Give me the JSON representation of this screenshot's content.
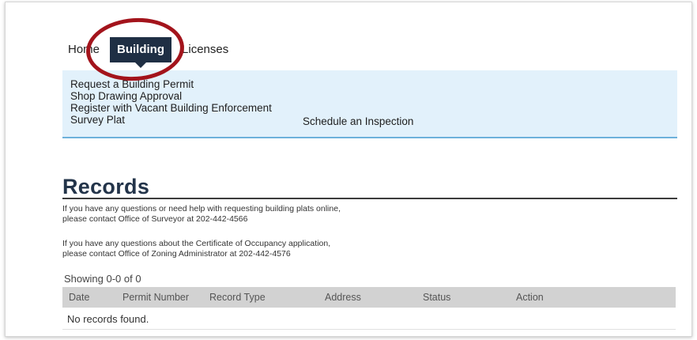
{
  "tabs": [
    {
      "label": "Home",
      "active": false
    },
    {
      "label": "Building",
      "active": true
    },
    {
      "label": "Licenses",
      "active": false
    }
  ],
  "building_menu": {
    "links": [
      "Request a Building Permit",
      "Shop Drawing Approval",
      "Register with Vacant Building Enforcement",
      "Survey Plat",
      "Schedule an Inspection"
    ]
  },
  "records": {
    "title": "Records",
    "info_surveyor_line1": "If you have any questions or need help with requesting building plats online,",
    "info_surveyor_line2": "please contact Office of Surveyor at 202-442-4566",
    "info_zoning_line1": "If you have any questions about the Certificate of Occupancy application,",
    "info_zoning_line2": "please contact Office of Zoning Administrator at 202-442-4576",
    "showing": "Showing 0-0 of 0",
    "columns": [
      "Date",
      "Permit Number",
      "Record Type",
      "Address",
      "Status",
      "Action"
    ],
    "empty_message": "No records found."
  },
  "colors": {
    "active_tab": "#1f2f44",
    "menu_background": "#e2f1fb",
    "menu_border": "#6db1db",
    "highlight_oval": "#a3141c",
    "table_header": "#d2d2d2"
  }
}
